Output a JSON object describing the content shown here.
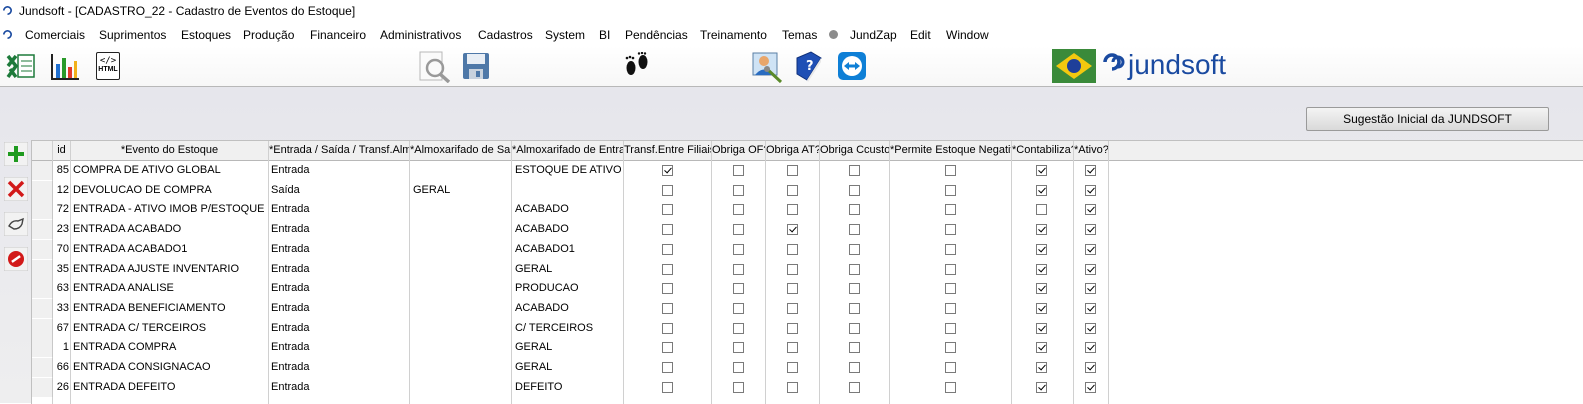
{
  "window": {
    "title": "Jundsoft - [CADASTRO_22 - Cadastro de Eventos do Estoque]"
  },
  "menu": [
    "Comerciais",
    "Suprimentos",
    "Estoques",
    "Produção",
    "Financeiro",
    "Administrativos",
    "Cadastros",
    "System",
    "BI",
    "Pendências",
    "Treinamento",
    "Temas",
    "JundZap",
    "Edit",
    "Window"
  ],
  "toolbar": {
    "icons": [
      "excel-icon",
      "chart-icon",
      "html-icon",
      "search-icon",
      "save-icon",
      "footsteps-icon",
      "user-settings-icon",
      "help-book-icon",
      "teamviewer-icon"
    ],
    "html_label": "</>",
    "html_sub": "HTML"
  },
  "logo": {
    "text": "jundsoft"
  },
  "suggest_button": "Sugestão Inicial da JUNDSOFT",
  "side_tools": [
    "add-icon",
    "delete-icon",
    "edit-icon",
    "cancel-icon"
  ],
  "grid": {
    "columns": [
      "id",
      "*Evento do Estoque",
      "*Entrada / Saída / Transf.Almox.",
      "*Almoxarifado de Saída",
      "*Almoxarifado de Entrada",
      "Transf.Entre Filiais?",
      "Obriga OF?",
      "Obriga AT?",
      "Obriga Ccusto?",
      "*Permite Estoque Negativo?",
      "*Contabiliza?",
      "*Ativo?"
    ],
    "rows": [
      {
        "id": "85",
        "evento": "COMPRA DE ATIVO GLOBAL",
        "tipo": "Entrada",
        "saida": "",
        "entrada": "ESTOQUE DE ATIVO",
        "transf": true,
        "of": false,
        "at": false,
        "ccusto": false,
        "negativo": false,
        "contabiliza": true,
        "ativo": true
      },
      {
        "id": "12",
        "evento": "DEVOLUCAO DE COMPRA",
        "tipo": "Saída",
        "saida": "GERAL",
        "entrada": "",
        "transf": false,
        "of": false,
        "at": false,
        "ccusto": false,
        "negativo": false,
        "contabiliza": true,
        "ativo": true
      },
      {
        "id": "72",
        "evento": "ENTRADA - ATIVO IMOB P/ESTOQUE",
        "tipo": "Entrada",
        "saida": "",
        "entrada": "ACABADO",
        "transf": false,
        "of": false,
        "at": false,
        "ccusto": false,
        "negativo": false,
        "contabiliza": false,
        "ativo": true
      },
      {
        "id": "23",
        "evento": "ENTRADA ACABADO",
        "tipo": "Entrada",
        "saida": "",
        "entrada": "ACABADO",
        "transf": false,
        "of": false,
        "at": true,
        "ccusto": false,
        "negativo": false,
        "contabiliza": true,
        "ativo": true
      },
      {
        "id": "70",
        "evento": "ENTRADA ACABADO1",
        "tipo": "Entrada",
        "saida": "",
        "entrada": "ACABADO1",
        "transf": false,
        "of": false,
        "at": false,
        "ccusto": false,
        "negativo": false,
        "contabiliza": true,
        "ativo": true
      },
      {
        "id": "35",
        "evento": "ENTRADA AJUSTE INVENTARIO",
        "tipo": "Entrada",
        "saida": "",
        "entrada": "GERAL",
        "transf": false,
        "of": false,
        "at": false,
        "ccusto": false,
        "negativo": false,
        "contabiliza": true,
        "ativo": true
      },
      {
        "id": "63",
        "evento": "ENTRADA ANALISE",
        "tipo": "Entrada",
        "saida": "",
        "entrada": "PRODUCAO",
        "transf": false,
        "of": false,
        "at": false,
        "ccusto": false,
        "negativo": false,
        "contabiliza": true,
        "ativo": true
      },
      {
        "id": "33",
        "evento": "ENTRADA BENEFICIAMENTO",
        "tipo": "Entrada",
        "saida": "",
        "entrada": "ACABADO",
        "transf": false,
        "of": false,
        "at": false,
        "ccusto": false,
        "negativo": false,
        "contabiliza": true,
        "ativo": true
      },
      {
        "id": "67",
        "evento": "ENTRADA C/ TERCEIROS",
        "tipo": "Entrada",
        "saida": "",
        "entrada": "C/ TERCEIROS",
        "transf": false,
        "of": false,
        "at": false,
        "ccusto": false,
        "negativo": false,
        "contabiliza": true,
        "ativo": true
      },
      {
        "id": "1",
        "evento": "ENTRADA COMPRA",
        "tipo": "Entrada",
        "saida": "",
        "entrada": "GERAL",
        "transf": false,
        "of": false,
        "at": false,
        "ccusto": false,
        "negativo": false,
        "contabiliza": true,
        "ativo": true
      },
      {
        "id": "66",
        "evento": "ENTRADA CONSIGNACAO",
        "tipo": "Entrada",
        "saida": "",
        "entrada": "GERAL",
        "transf": false,
        "of": false,
        "at": false,
        "ccusto": false,
        "negativo": false,
        "contabiliza": true,
        "ativo": true
      },
      {
        "id": "26",
        "evento": "ENTRADA DEFEITO",
        "tipo": "Entrada",
        "saida": "",
        "entrada": "DEFEITO",
        "transf": false,
        "of": false,
        "at": false,
        "ccusto": false,
        "negativo": false,
        "contabiliza": true,
        "ativo": true
      }
    ]
  },
  "colors": {
    "accent": "#1a4aa0",
    "add": "#1e9a1e",
    "delete": "#d21919"
  }
}
